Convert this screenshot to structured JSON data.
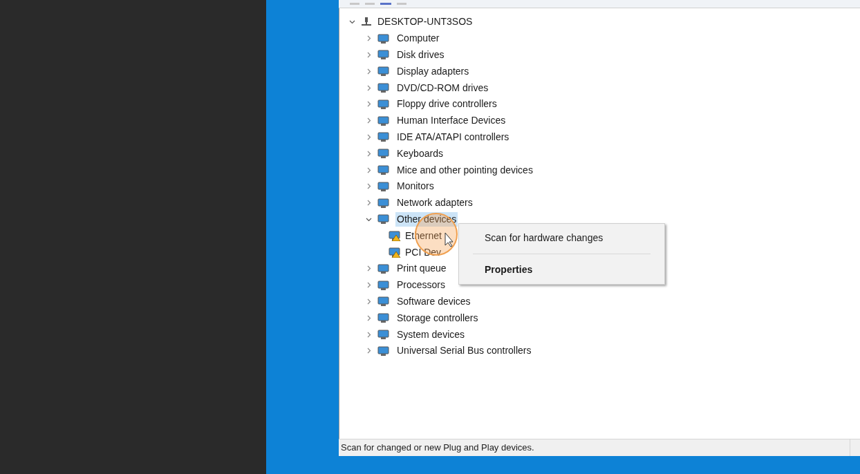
{
  "tree": {
    "label": "DESKTOP-UNT3SOS",
    "expanded": true,
    "children": [
      {
        "label": "Computer",
        "expanded": false,
        "selected": false
      },
      {
        "label": "Disk drives",
        "expanded": false,
        "selected": false
      },
      {
        "label": "Display adapters",
        "expanded": false,
        "selected": false
      },
      {
        "label": "DVD/CD-ROM drives",
        "expanded": false,
        "selected": false
      },
      {
        "label": "Floppy drive controllers",
        "expanded": false,
        "selected": false
      },
      {
        "label": "Human Interface Devices",
        "expanded": false,
        "selected": false
      },
      {
        "label": "IDE ATA/ATAPI controllers",
        "expanded": false,
        "selected": false
      },
      {
        "label": "Keyboards",
        "expanded": false,
        "selected": false
      },
      {
        "label": "Mice and other pointing devices",
        "expanded": false,
        "selected": false
      },
      {
        "label": "Monitors",
        "expanded": false,
        "selected": false
      },
      {
        "label": "Network adapters",
        "expanded": false,
        "selected": false
      },
      {
        "label": "Other devices",
        "expanded": true,
        "selected": true,
        "children": [
          {
            "label": "Ethernet",
            "warning": true
          },
          {
            "label": "PCI Dev",
            "warning": true
          }
        ]
      },
      {
        "label": "Print queue",
        "expanded": false,
        "selected": false
      },
      {
        "label": "Processors",
        "expanded": false,
        "selected": false
      },
      {
        "label": "Software devices",
        "expanded": false,
        "selected": false
      },
      {
        "label": "Storage controllers",
        "expanded": false,
        "selected": false
      },
      {
        "label": "System devices",
        "expanded": false,
        "selected": false
      },
      {
        "label": "Universal Serial Bus controllers",
        "expanded": false,
        "selected": false
      }
    ]
  },
  "context_menu": [
    {
      "label": "Scan for hardware changes",
      "default": false
    },
    {
      "label": "Properties",
      "default": true
    }
  ],
  "status_bar": "Scan for changed or new Plug and Play devices."
}
